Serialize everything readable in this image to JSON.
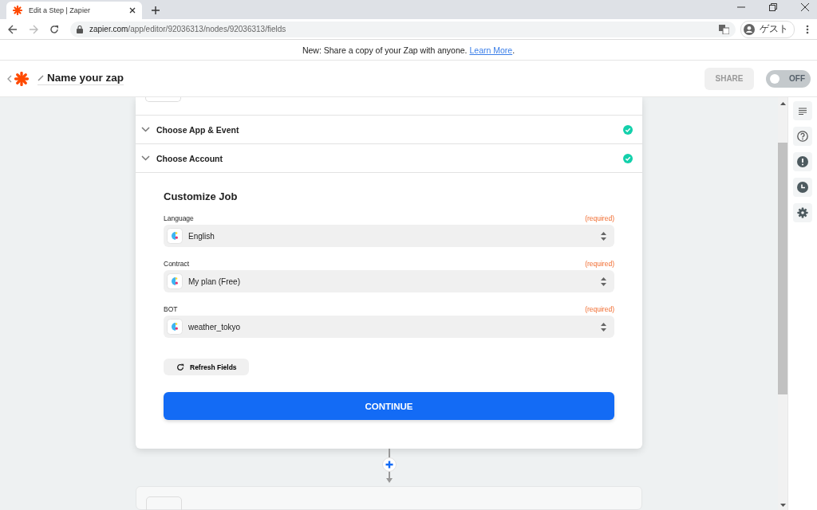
{
  "browser": {
    "tab_title": "Edit a Step | Zapier",
    "url_host": "zapier.com",
    "url_path": "/app/editor/92036313/nodes/92036313/fields",
    "profile_label": "ゲスト"
  },
  "banner": {
    "text": "New: Share a copy of your Zap with anyone.",
    "link": "Learn More",
    "after": "."
  },
  "header": {
    "zap_name": "Name your zap",
    "share_button": "SHARE",
    "toggle": {
      "on": false,
      "label": "OFF"
    }
  },
  "sections": [
    {
      "title": "Choose App & Event",
      "done": true
    },
    {
      "title": "Choose Account",
      "done": true
    }
  ],
  "form": {
    "title": "Customize Job",
    "fields": [
      {
        "label": "Language",
        "required": "(required)",
        "value": "English"
      },
      {
        "label": "Contract",
        "required": "(required)",
        "value": "My plan (Free)"
      },
      {
        "label": "BOT",
        "required": "(required)",
        "value": "weather_tokyo"
      }
    ],
    "refresh_button": "Refresh Fields",
    "continue_button": "CONTINUE"
  }
}
